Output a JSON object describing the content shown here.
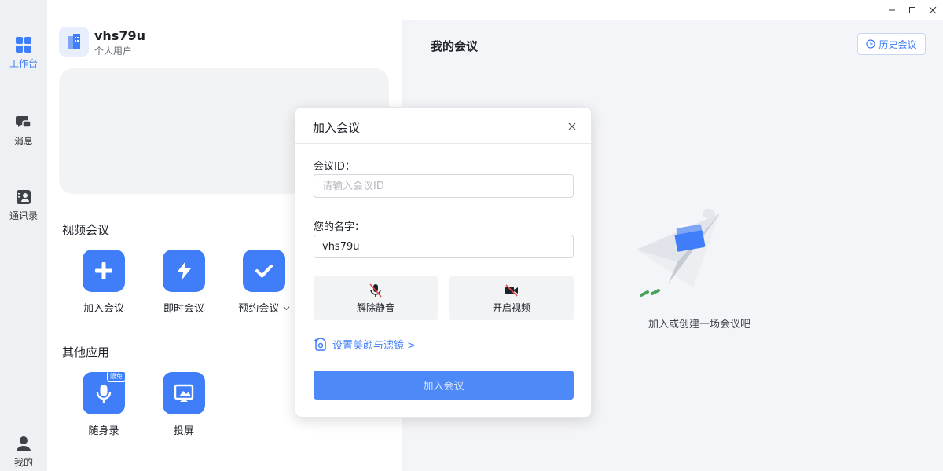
{
  "nav": {
    "items": [
      {
        "label": "工作台"
      },
      {
        "label": "消息"
      },
      {
        "label": "通讯录"
      },
      {
        "label": "我的"
      }
    ]
  },
  "user": {
    "name": "vhs79u",
    "type": "个人用户"
  },
  "sections": {
    "video": "视频会议",
    "other": "其他应用"
  },
  "apps": {
    "join": "加入会议",
    "instant": "即时会议",
    "schedule": "预约会议",
    "recorder": "随身录",
    "recorder_badge": "限免",
    "share": "投屏"
  },
  "right": {
    "title": "我的会议",
    "history": "历史会议",
    "empty": "加入或创建一场会议吧"
  },
  "modal": {
    "title": "加入会议",
    "id_label": "会议ID：",
    "id_placeholder": "请输入会议ID",
    "name_label": "您的名字：",
    "name_value": "vhs79u",
    "mic_label": "解除静音",
    "video_label": "开启视频",
    "beauty_link": "设置美颜与滤镜 >",
    "join_button": "加入会议"
  },
  "colors": {
    "accent": "#3f7ef8",
    "tile": "#3f7ef8",
    "join_button": "#4d8af8"
  }
}
